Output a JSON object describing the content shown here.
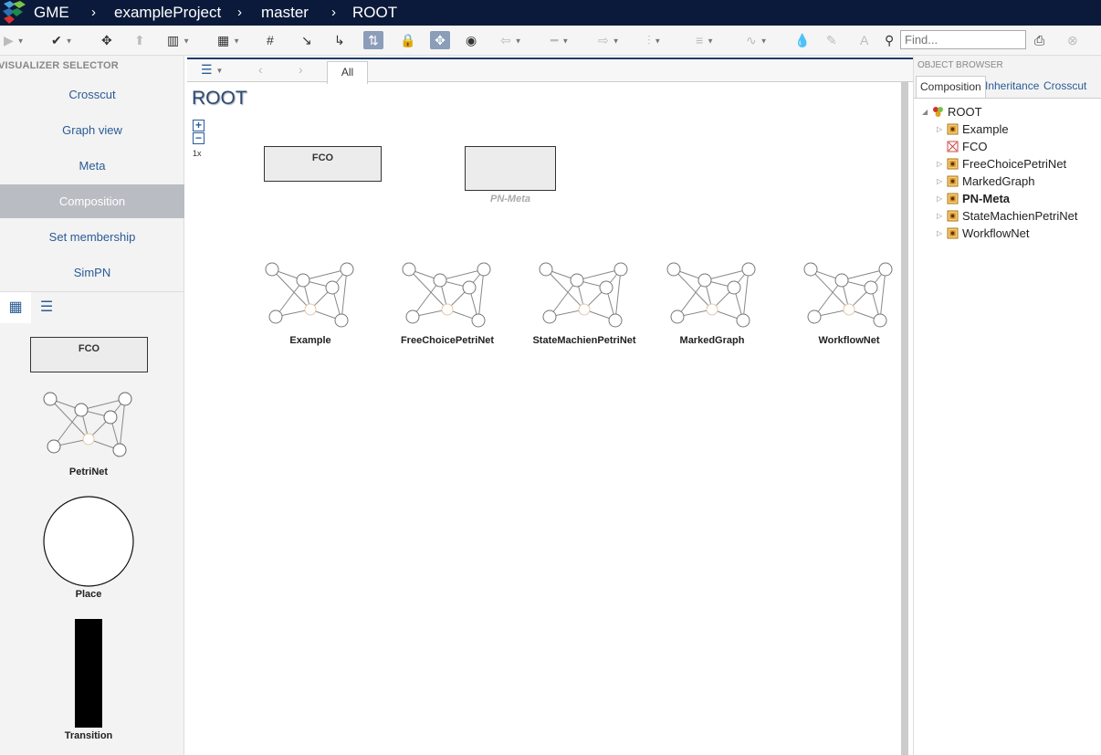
{
  "topbar": {
    "app": "GME",
    "breadcrumb": [
      "exampleProject",
      "master",
      "ROOT"
    ]
  },
  "toolbar": {
    "search_placeholder": "Find..."
  },
  "left": {
    "title": "VISUALIZER SELECTOR",
    "items": [
      "Crosscut",
      "Graph view",
      "Meta",
      "Composition",
      "Set membership",
      "SimPN"
    ],
    "selected": "Composition",
    "palette": [
      "FCO",
      "PetriNet",
      "Place",
      "Transition"
    ]
  },
  "center": {
    "tab": "All",
    "title": "ROOT",
    "zoom": "1x",
    "fco_label": "FCO",
    "pnmeta_label": "PN-Meta",
    "models": [
      "Example",
      "FreeChoicePetriNet",
      "StateMachienPetriNet",
      "MarkedGraph",
      "WorkflowNet"
    ]
  },
  "right": {
    "title": "OBJECT BROWSER",
    "tabs": [
      "Composition",
      "Inheritance",
      "Crosscut"
    ],
    "root": "ROOT",
    "children": [
      "Example",
      "FCO",
      "FreeChoicePetriNet",
      "MarkedGraph",
      "PN-Meta",
      "StateMachienPetriNet",
      "WorkflowNet"
    ]
  }
}
